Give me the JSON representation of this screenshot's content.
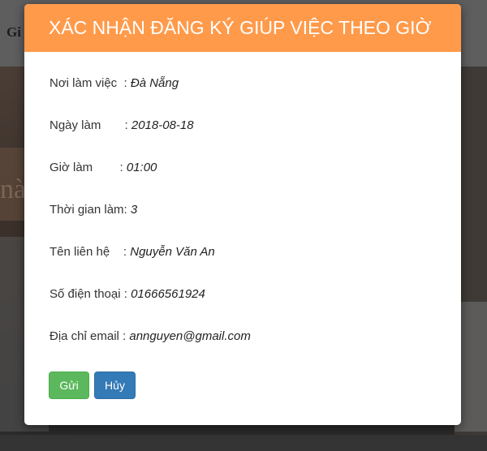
{
  "background": {
    "brand": "Gi",
    "hero_glyph": "nà"
  },
  "modal": {
    "title": "XÁC NHẬN ĐĂNG KÝ GIÚP VIỆC THEO GIỜ",
    "rows": [
      {
        "label": "Nơi làm việc  : ",
        "value": "Đà Nẵng"
      },
      {
        "label": "Ngày làm       : ",
        "value": "2018-08-18"
      },
      {
        "label": "Giờ làm        : ",
        "value": "01:00"
      },
      {
        "label": "Thời gian làm: ",
        "value": "3"
      },
      {
        "label": "Tên liên hệ    : ",
        "value": "Nguyễn Văn An"
      },
      {
        "label": "Số điện thoại : ",
        "value": "01666561924"
      },
      {
        "label": "Địa chỉ email : ",
        "value": "annguyen@gmail.com"
      }
    ],
    "buttons": {
      "send": "Gửi",
      "cancel": "Hủy"
    }
  },
  "colors": {
    "header": "#ff9a4a",
    "send": "#5cb85c",
    "cancel": "#337ab7"
  }
}
